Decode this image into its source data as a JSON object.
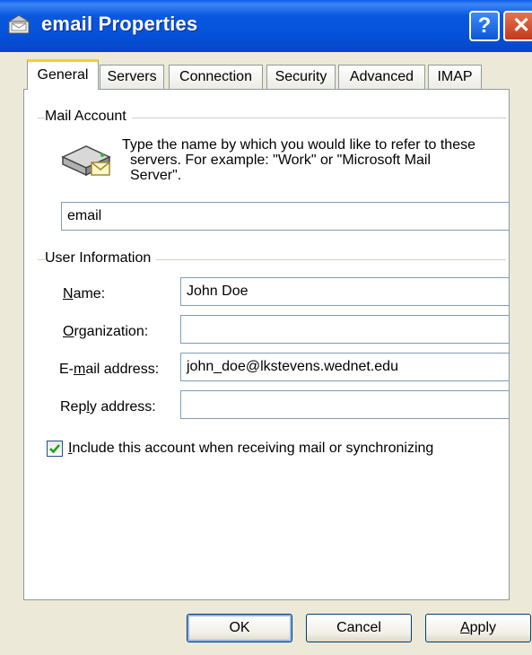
{
  "window": {
    "title": "email Properties",
    "help_symbol": "?",
    "close_symbol": "✕"
  },
  "tabs": [
    {
      "label": "General",
      "active": true
    },
    {
      "label": "Servers",
      "active": false
    },
    {
      "label": "Connection",
      "active": false
    },
    {
      "label": "Security",
      "active": false
    },
    {
      "label": "Advanced",
      "active": false
    },
    {
      "label": "IMAP",
      "active": false
    }
  ],
  "mail_account": {
    "group_label": "Mail Account",
    "description_lines": [
      "Type the name by which you would like to refer to these",
      "servers.  For example: \"Work\" or \"Microsoft Mail",
      "Server\"."
    ],
    "account_name": "email",
    "icon": "mail-server-icon"
  },
  "user_information": {
    "group_label": "User Information",
    "name_label": {
      "pre": "",
      "key": "N",
      "post": "ame:"
    },
    "name_value": "John Doe",
    "organization_label": {
      "pre": "",
      "key": "O",
      "post": "rganization:"
    },
    "organization_value": "",
    "email_label": {
      "pre": "E-",
      "key": "m",
      "post": "ail address:"
    },
    "email_value": "john_doe@lkstevens.wednet.edu",
    "reply_label": {
      "pre": "Rep",
      "key": "l",
      "post": "y address:"
    },
    "reply_value": ""
  },
  "include_account": {
    "checked": true,
    "label": {
      "pre": "",
      "key": "I",
      "post": "nclude this account when receiving mail or synchronizing"
    }
  },
  "buttons": {
    "ok": "OK",
    "cancel": "Cancel",
    "apply": {
      "pre": "",
      "key": "A",
      "post": "pply"
    }
  },
  "colors": {
    "titlebar": "#0a58e0",
    "dialog_bg": "#ece9d8",
    "tab_highlight": "#ffc83c",
    "checkmark": "#21a121"
  }
}
